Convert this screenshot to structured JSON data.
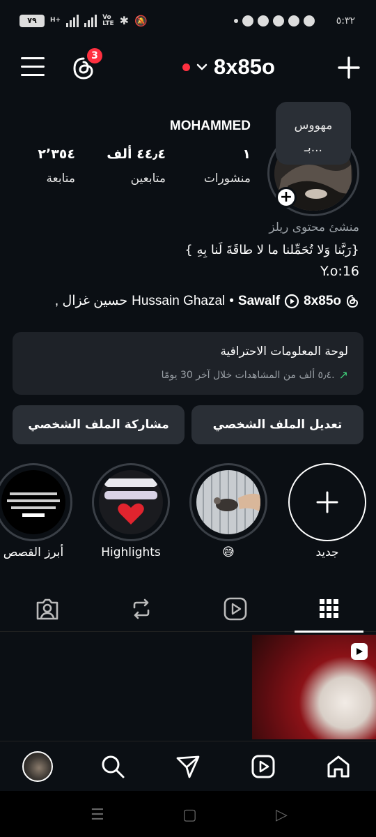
{
  "status_bar": {
    "time": "٥:٣٢",
    "battery": "٧٩",
    "network_labels": [
      "H+",
      "Vo",
      "LTE"
    ],
    "notification_icons": [
      "dot-icon",
      "messenger-icon",
      "messenger-icon",
      "messenger-icon",
      "whatsapp-icon",
      "messenger-icon"
    ],
    "system_icons": [
      "bluetooth-icon",
      "mute-icon"
    ]
  },
  "header": {
    "username": "8x85o",
    "threads_badge": "3"
  },
  "note": {
    "line1": "مهووس",
    "line2": "بـ..."
  },
  "profile": {
    "display_name": "MOHAMMED",
    "stats": [
      {
        "value": "١",
        "label": "منشورات"
      },
      {
        "value": "٤٤٫٤ ألف",
        "label": "متابعين"
      },
      {
        "value": "٢٬٣٥٤",
        "label": "متابعة"
      }
    ],
    "category": "منشئ محتوى ريلز",
    "bio_line1": "{ رَبَّنا وَلا تُحَمِّلنا ما لا طاقَةَ لَنا بِهِ}",
    "bio_line2": "Y.o:16",
    "links": {
      "threads": "8x85o",
      "reels": "Sawalf",
      "separator": "•",
      "tagged": "Hussain Ghazal",
      "tagged_ar": ", حسين غزال"
    }
  },
  "dashboard": {
    "title": "لوحة المعلومات الاحترافية",
    "subtitle": "٥٫٤ ألف من المشاهدات خلال آخر 30 يومًا."
  },
  "actions": {
    "edit": "تعديل الملف الشخصي",
    "share": "مشاركة الملف الشخصي"
  },
  "highlights": [
    {
      "label": "جديد"
    },
    {
      "label": "😅"
    },
    {
      "label": "Highlights"
    },
    {
      "label": "أبرز القصص"
    }
  ],
  "colors": {
    "background": "#0b0f14",
    "accent_red": "#ff3040",
    "card": "#1e2228",
    "button": "#2a2f36",
    "growth_green": "#3fd17a"
  }
}
